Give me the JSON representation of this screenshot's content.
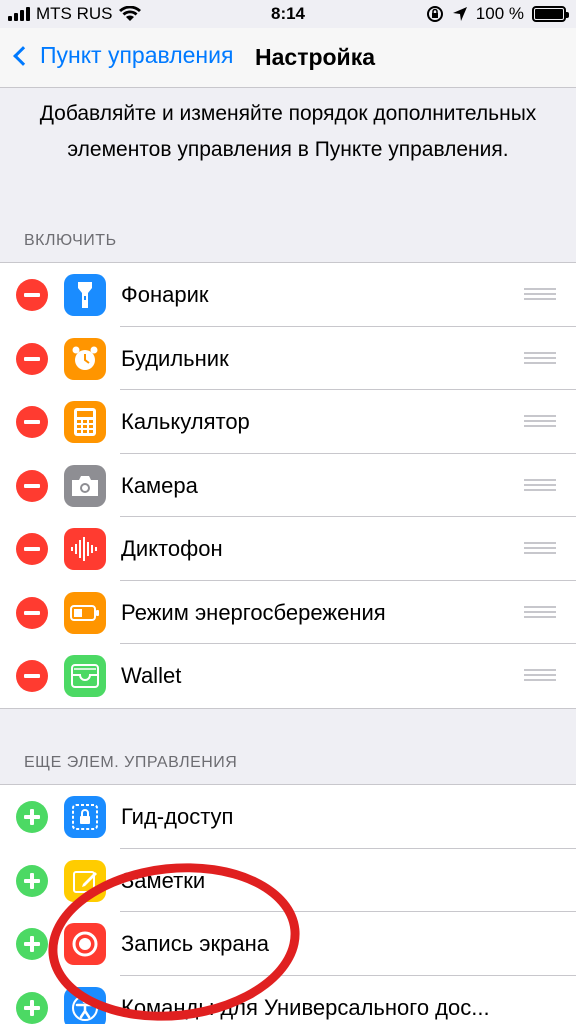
{
  "status_bar": {
    "carrier": "MTS RUS",
    "time": "8:14",
    "battery": "100 %"
  },
  "nav": {
    "back_label": "Пункт управления",
    "title": "Настройка"
  },
  "description": "Добавляйте и изменяйте порядок дополнительных элементов управления в Пункте управления.",
  "include_section": {
    "header": "ВКЛЮЧИТЬ",
    "items": [
      {
        "label": "Фонарик",
        "icon": "flashlight-icon",
        "color": "#1a8cff"
      },
      {
        "label": "Будильник",
        "icon": "alarm-clock-icon",
        "color": "#ff9500"
      },
      {
        "label": "Калькулятор",
        "icon": "calculator-icon",
        "color": "#ff9500"
      },
      {
        "label": "Камера",
        "icon": "camera-icon",
        "color": "#8e8e93"
      },
      {
        "label": "Диктофон",
        "icon": "voice-memo-icon",
        "color": "#ff3b30"
      },
      {
        "label": "Режим энергосбережения",
        "icon": "battery-icon",
        "color": "#ff9500"
      },
      {
        "label": "Wallet",
        "icon": "wallet-icon",
        "color": "#4cd964"
      }
    ]
  },
  "more_section": {
    "header": "ЕЩЕ ЭЛЕМ. УПРАВЛЕНИЯ",
    "items": [
      {
        "label": "Гид-доступ",
        "icon": "guided-access-icon",
        "color": "#1a8cff"
      },
      {
        "label": "Заметки",
        "icon": "notes-icon",
        "color": "#ffcc00"
      },
      {
        "label": "Запись экрана",
        "icon": "screen-record-icon",
        "color": "#ff3b30"
      },
      {
        "label": "Команды для Универсального дос...",
        "icon": "accessibility-icon",
        "color": "#1a8cff"
      }
    ]
  },
  "colors": {
    "accent": "#007aff",
    "remove": "#ff3b30",
    "add": "#4cd964",
    "annotation": "#e02020"
  }
}
